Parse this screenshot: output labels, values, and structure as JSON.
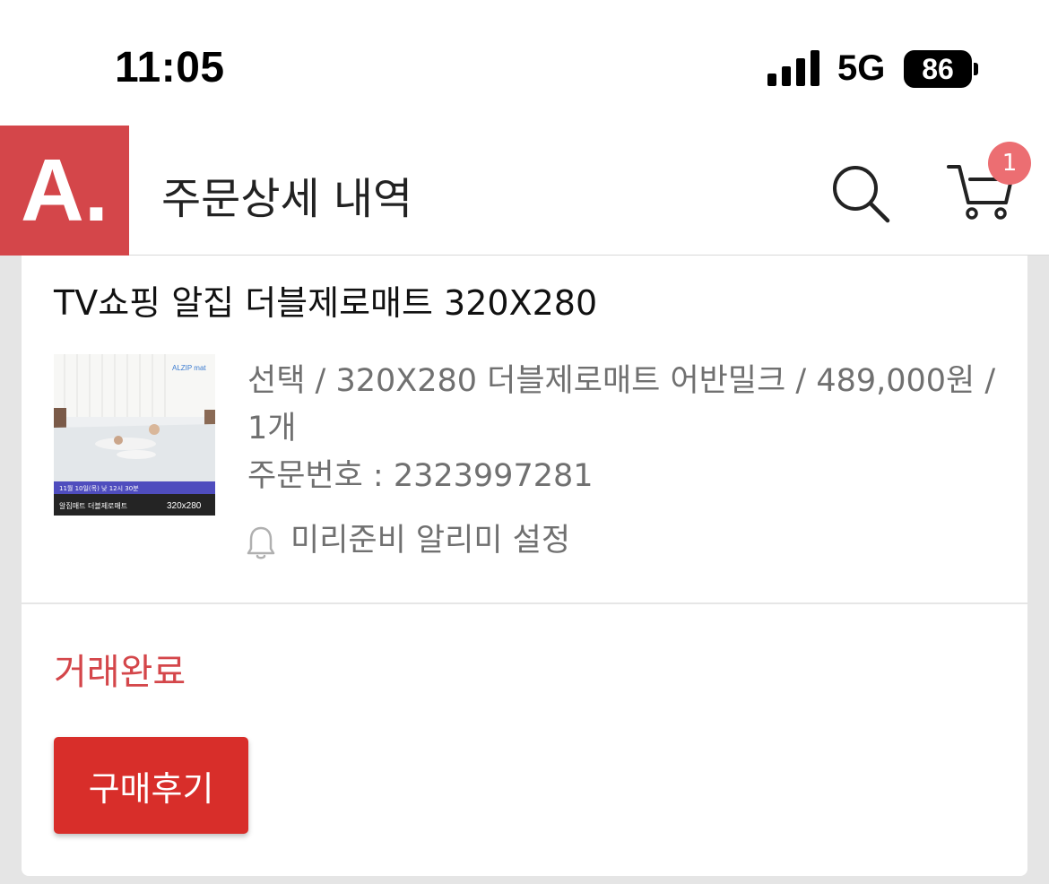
{
  "status_bar": {
    "time": "11:05",
    "network": "5G",
    "battery": "86"
  },
  "header": {
    "logo": "A.",
    "title": "주문상세 내역",
    "cart_count": "1"
  },
  "order": {
    "product_title": "TV쇼핑 알집 더블제로매트 320X280",
    "thumbnail": {
      "brand": "ALZIP mat",
      "date_text": "11월 10일(목) 낮 12시 30분",
      "product_label": "알집매트 더블제로매트",
      "size_label": "320x280"
    },
    "option_text": "선택 / 320X280 더블제로매트 어반밀크 / 489,000원 / 1개",
    "order_number": "주문번호 : 2323997281",
    "alert_label": "미리준비 알리미 설정",
    "status": "거래완료",
    "review_button": "구매후기"
  },
  "colors": {
    "brand": "#d4464a",
    "status": "#d4464a",
    "review_button": "#d82e2a",
    "badge": "#ec6e72"
  },
  "icons": [
    "signal-icon",
    "battery-icon",
    "search-icon",
    "cart-icon",
    "bell-icon"
  ]
}
